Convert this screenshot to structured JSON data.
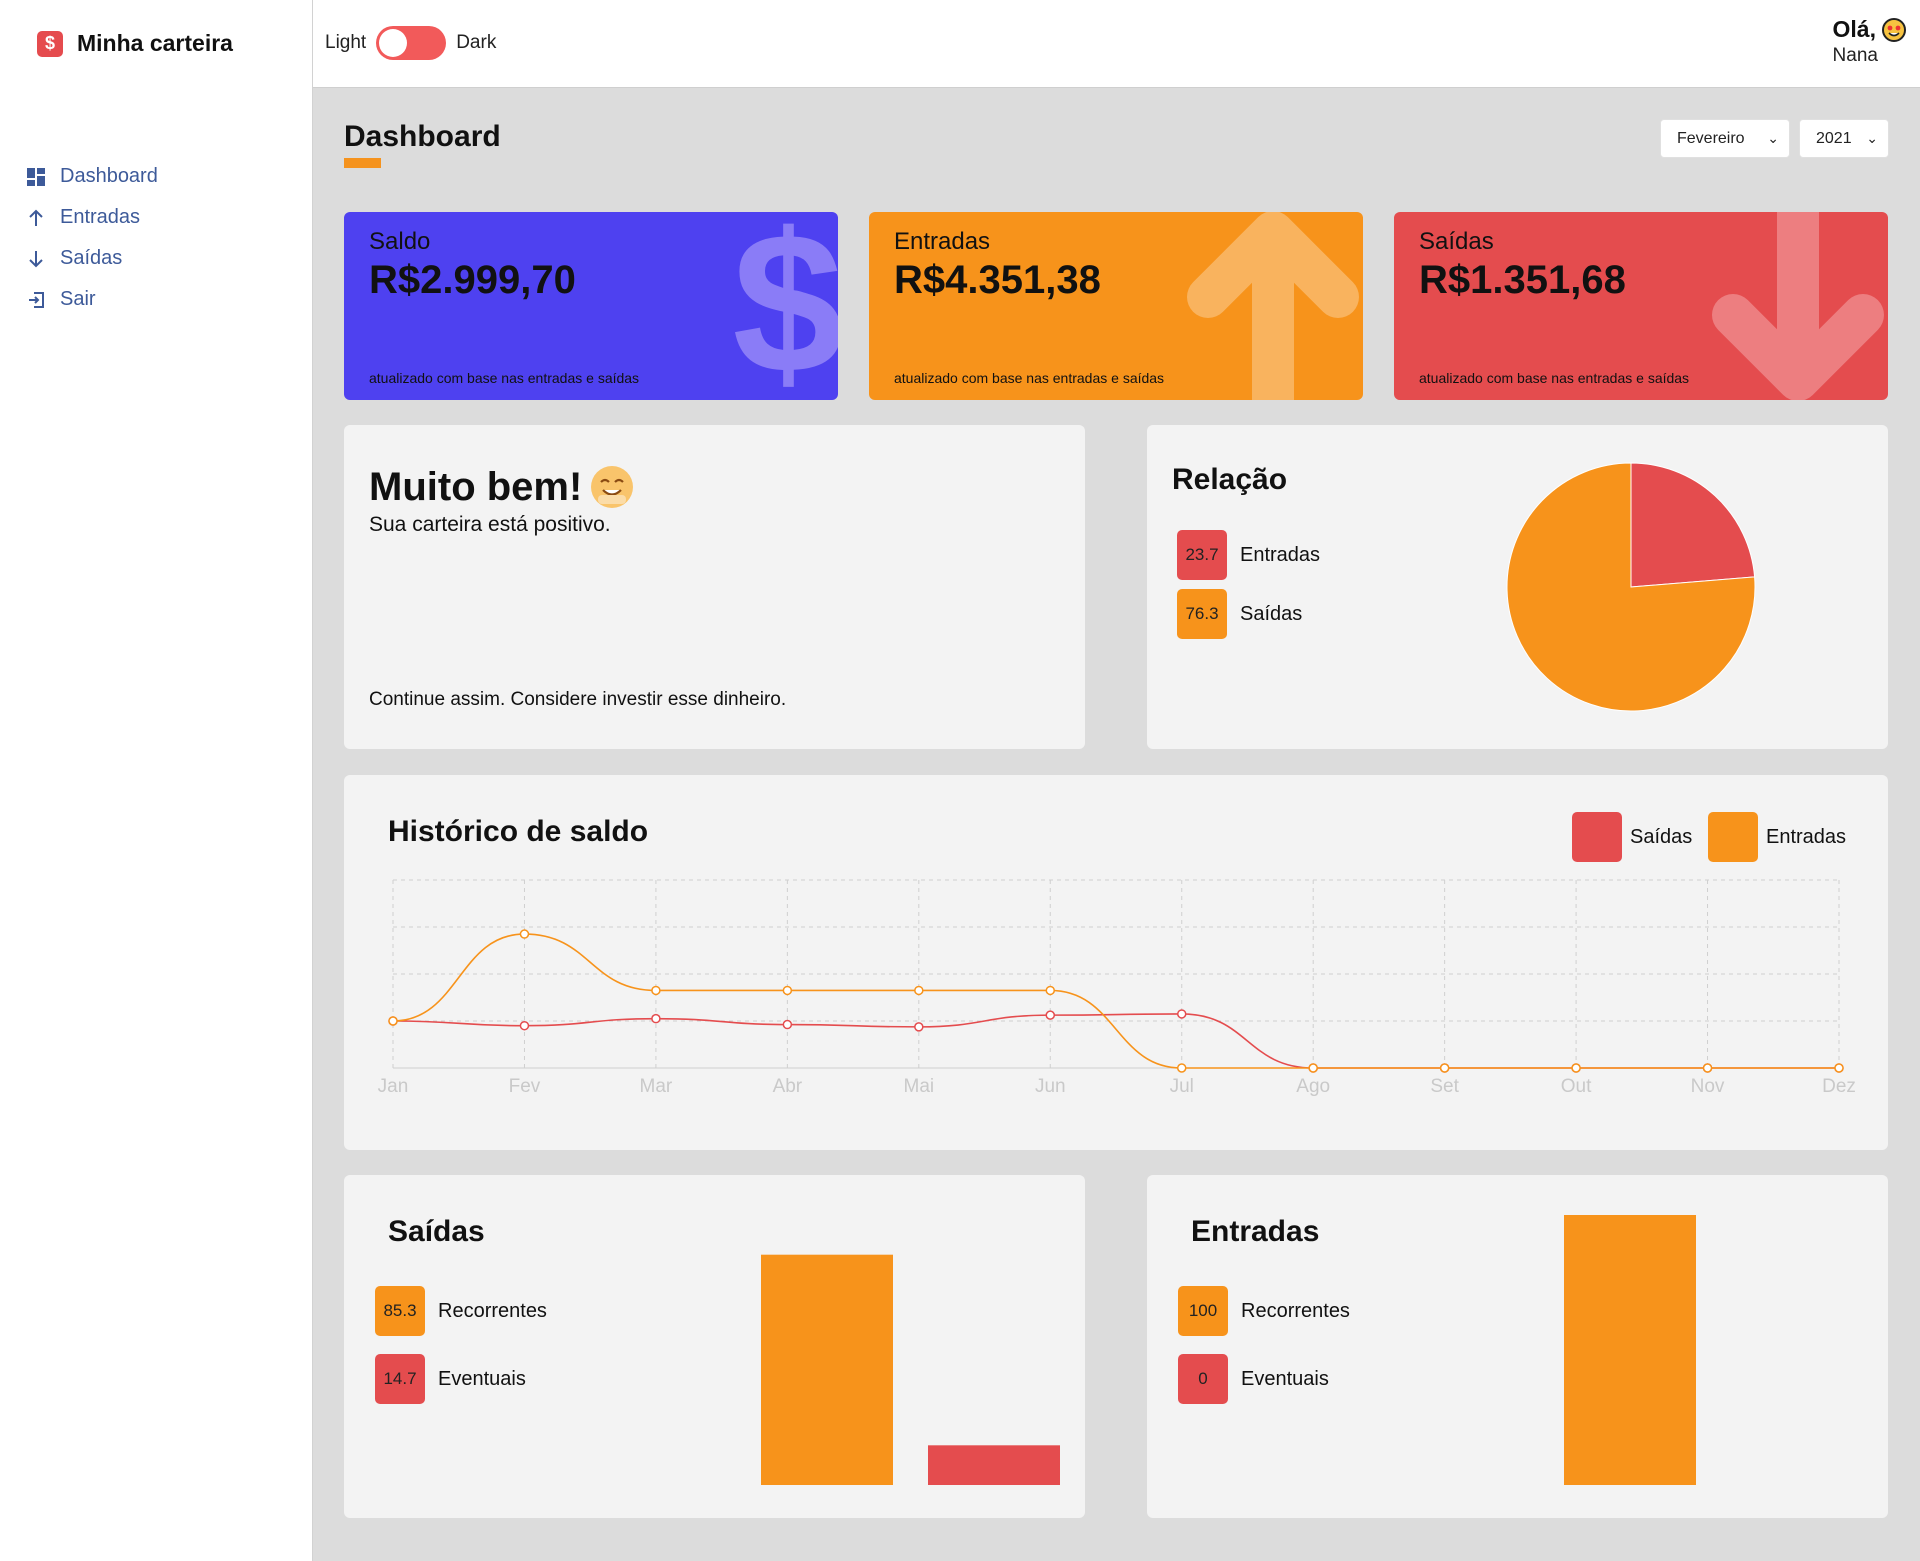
{
  "app": {
    "brand": "Minha carteira",
    "brand_icon": "dollar-icon"
  },
  "sidebar": {
    "items": [
      {
        "label": "Dashboard",
        "icon": "dashboard-icon"
      },
      {
        "label": "Entradas",
        "icon": "arrow-up-icon"
      },
      {
        "label": "Saídas",
        "icon": "arrow-down-icon"
      },
      {
        "label": "Sair",
        "icon": "exit-icon"
      }
    ]
  },
  "header": {
    "theme_light": "Light",
    "theme_dark": "Dark",
    "greeting": "Olá,",
    "user": "Nana"
  },
  "page": {
    "title": "Dashboard",
    "month": "Fevereiro",
    "year": "2021"
  },
  "wallet": [
    {
      "label": "Saldo",
      "value": "R$2.999,70",
      "foot": "atualizado com base nas entradas e saídas",
      "color": "#4e41f0",
      "icon": "dollar-icon"
    },
    {
      "label": "Entradas",
      "value": "R$4.351,38",
      "foot": "atualizado com base nas entradas e saídas",
      "color": "#f7931b",
      "icon": "arrow-up-icon"
    },
    {
      "label": "Saídas",
      "value": "R$1.351,68",
      "foot": "atualizado com base nas entradas e saídas",
      "color": "#e44c4e",
      "icon": "arrow-down-icon"
    }
  ],
  "message": {
    "title": "Muito bem!",
    "subtitle": "Sua carteira está positivo.",
    "foot": "Continue assim. Considere investir esse dinheiro.",
    "icon": "happy-emoji-icon"
  },
  "relation": {
    "title": "Relação",
    "items": [
      {
        "value": "23.7",
        "label": "Entradas",
        "color": "#e44c4e"
      },
      {
        "value": "76.3",
        "label": "Saídas",
        "color": "#f7931b"
      }
    ]
  },
  "history": {
    "title": "Histórico de saldo",
    "legend": [
      {
        "label": "Saídas",
        "color": "#e44c4e"
      },
      {
        "label": "Entradas",
        "color": "#f7931b"
      }
    ]
  },
  "outflows": {
    "title": "Saídas",
    "items": [
      {
        "value": "85.3",
        "label": "Recorrentes",
        "color": "#f7931b"
      },
      {
        "value": "14.7",
        "label": "Eventuais",
        "color": "#e44c4e"
      }
    ]
  },
  "inflows": {
    "title": "Entradas",
    "items": [
      {
        "value": "100",
        "label": "Recorrentes",
        "color": "#f7931b"
      },
      {
        "value": "0",
        "label": "Eventuais",
        "color": "#e44c4e"
      }
    ]
  },
  "chart_data": [
    {
      "type": "pie",
      "title": "Relação",
      "categories": [
        "Entradas",
        "Saídas"
      ],
      "values": [
        23.7,
        76.3
      ],
      "colors": [
        "#e44c4e",
        "#f7931b"
      ]
    },
    {
      "type": "line",
      "title": "Histórico de saldo",
      "categories": [
        "Jan",
        "Fev",
        "Mar",
        "Abr",
        "Mai",
        "Jun",
        "Jul",
        "Ago",
        "Set",
        "Out",
        "Nov",
        "Dez"
      ],
      "series": [
        {
          "name": "Saídas",
          "color": "#e44c4e",
          "values": [
            1000,
            900,
            1050,
            925,
            875,
            1125,
            1150,
            0,
            0,
            0,
            0,
            0
          ]
        },
        {
          "name": "Entradas",
          "color": "#f7931b",
          "values": [
            1000,
            2850,
            1650,
            1650,
            1650,
            1650,
            0,
            0,
            0,
            0,
            0,
            0
          ]
        }
      ],
      "ylim": [
        0,
        4000
      ],
      "grid": true
    },
    {
      "type": "bar",
      "title": "Saídas",
      "categories": [
        "Recorrentes",
        "Eventuais"
      ],
      "values": [
        85.3,
        14.7
      ],
      "colors": [
        "#f7931b",
        "#e44c4e"
      ],
      "ylim": [
        0,
        100
      ]
    },
    {
      "type": "bar",
      "title": "Entradas",
      "categories": [
        "Recorrentes",
        "Eventuais"
      ],
      "values": [
        100,
        0
      ],
      "colors": [
        "#f7931b",
        "#e44c4e"
      ],
      "ylim": [
        0,
        100
      ]
    }
  ]
}
